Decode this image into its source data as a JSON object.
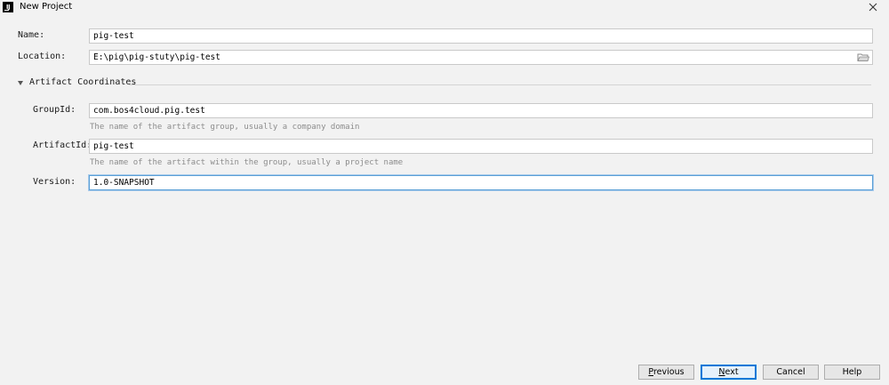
{
  "window": {
    "title": "New Project",
    "app_icon_text": "IJ",
    "close_icon": "close-icon"
  },
  "form": {
    "name": {
      "label": "Name:",
      "value": "pig-test"
    },
    "location": {
      "label": "Location:",
      "value": "E:\\pig\\pig-stuty\\pig-test",
      "browse_icon": "folder-icon"
    }
  },
  "artifact": {
    "section_title": "Artifact Coordinates",
    "expanded_icon": "triangle-down-icon",
    "group_id": {
      "label": "GroupId:",
      "value": "com.bos4cloud.pig.test",
      "hint": "The name of the artifact group, usually a company domain"
    },
    "artifact_id": {
      "label": "ArtifactId:",
      "value": "pig-test",
      "hint": "The name of the artifact within the group, usually a project name"
    },
    "version": {
      "label": "Version:",
      "value": "1.0-SNAPSHOT"
    }
  },
  "buttons": {
    "previous": {
      "mnemonic": "P",
      "rest": "revious"
    },
    "next": {
      "mnemonic": "N",
      "rest": "ext"
    },
    "cancel": "Cancel",
    "help": "Help"
  }
}
